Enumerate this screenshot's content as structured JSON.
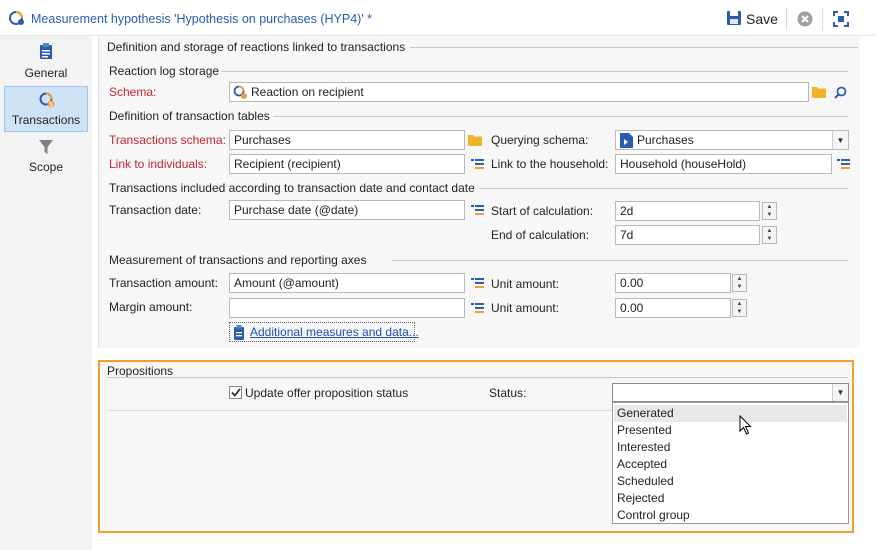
{
  "window": {
    "title": "Measurement hypothesis 'Hypothesis on purchases (HYP4)' *",
    "save_label": "Save"
  },
  "nav": {
    "items": [
      {
        "label": "General",
        "icon": "clipboard-icon"
      },
      {
        "label": "Transactions",
        "icon": "transactions-icon",
        "active": true
      },
      {
        "label": "Scope",
        "icon": "filter-icon"
      }
    ]
  },
  "main": {
    "section_title": "Definition and storage of reactions linked to transactions",
    "reaction_log": {
      "title": "Reaction log storage",
      "schema_label": "Schema:",
      "schema_value": "Reaction on recipient"
    },
    "transaction_tables": {
      "title": "Definition of transaction tables",
      "transactions_schema_label": "Transactions schema:",
      "transactions_schema_value": "Purchases",
      "querying_schema_label": "Querying schema:",
      "querying_schema_value": "Purchases",
      "link_individuals_label": "Link to individuals:",
      "link_individuals_value": "Recipient (recipient)",
      "link_household_label": "Link to the household:",
      "link_household_value": "Household (houseHold)"
    },
    "date_section": {
      "title": "Transactions included according to transaction date and contact date",
      "transaction_date_label": "Transaction date:",
      "transaction_date_value": "Purchase date (@date)",
      "start_label": "Start of calculation:",
      "start_value": "2d",
      "end_label": "End of calculation:",
      "end_value": "7d"
    },
    "measurement": {
      "title": "Measurement of transactions and reporting axes",
      "amount_label": "Transaction amount:",
      "amount_value": "Amount (@amount)",
      "unit_amount_label_1": "Unit amount:",
      "unit_amount_value_1": "0.00",
      "margin_label": "Margin amount:",
      "margin_value": "",
      "unit_amount_label_2": "Unit amount:",
      "unit_amount_value_2": "0.00",
      "additional_link": "Additional measures and data..."
    }
  },
  "propositions": {
    "title": "Propositions",
    "update_label": "Update offer proposition status",
    "update_checked": true,
    "status_label": "Status:",
    "status_value": "",
    "status_options": [
      "Generated",
      "Presented",
      "Interested",
      "Accepted",
      "Scheduled",
      "Rejected",
      "Control group"
    ],
    "highlighted_option": "Generated"
  },
  "colors": {
    "accent": "#2a5db0",
    "required_label": "#c0262c",
    "focus_border": "#f0a030",
    "nav_active": "#cfe3f6"
  }
}
